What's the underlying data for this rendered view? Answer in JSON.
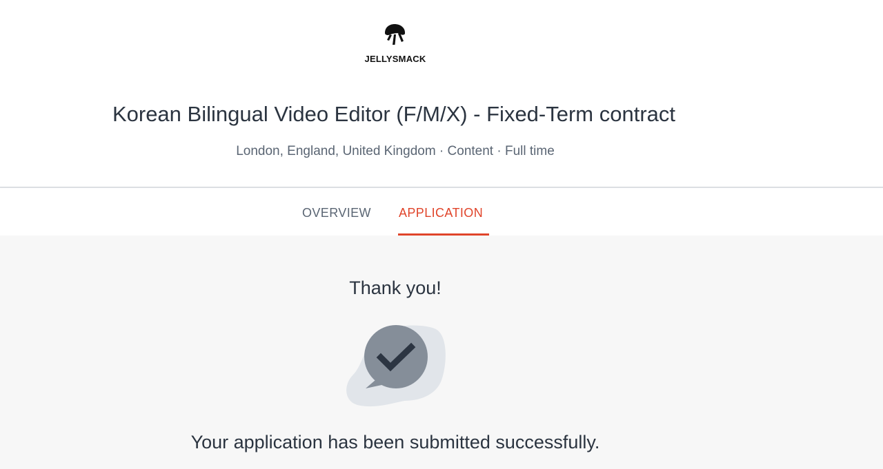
{
  "company": {
    "logo_text": "JELLYSMACK",
    "logo_icon": "jellyfish-logo-icon"
  },
  "job": {
    "title": "Korean Bilingual Video Editor (F/M/X) - Fixed-Term contract",
    "meta": "London, England, United Kingdom · Content · Full time"
  },
  "tabs": [
    {
      "label": "OVERVIEW",
      "active": false
    },
    {
      "label": "APPLICATION",
      "active": true
    }
  ],
  "colors": {
    "accent": "#e0442a",
    "text": "#2b3440",
    "muted": "#5a6573",
    "background": "#f7f7f7"
  },
  "confirmation": {
    "heading": "Thank you!",
    "icon": "chat-bubble-check-icon",
    "message": "Your application has been submitted successfully."
  }
}
